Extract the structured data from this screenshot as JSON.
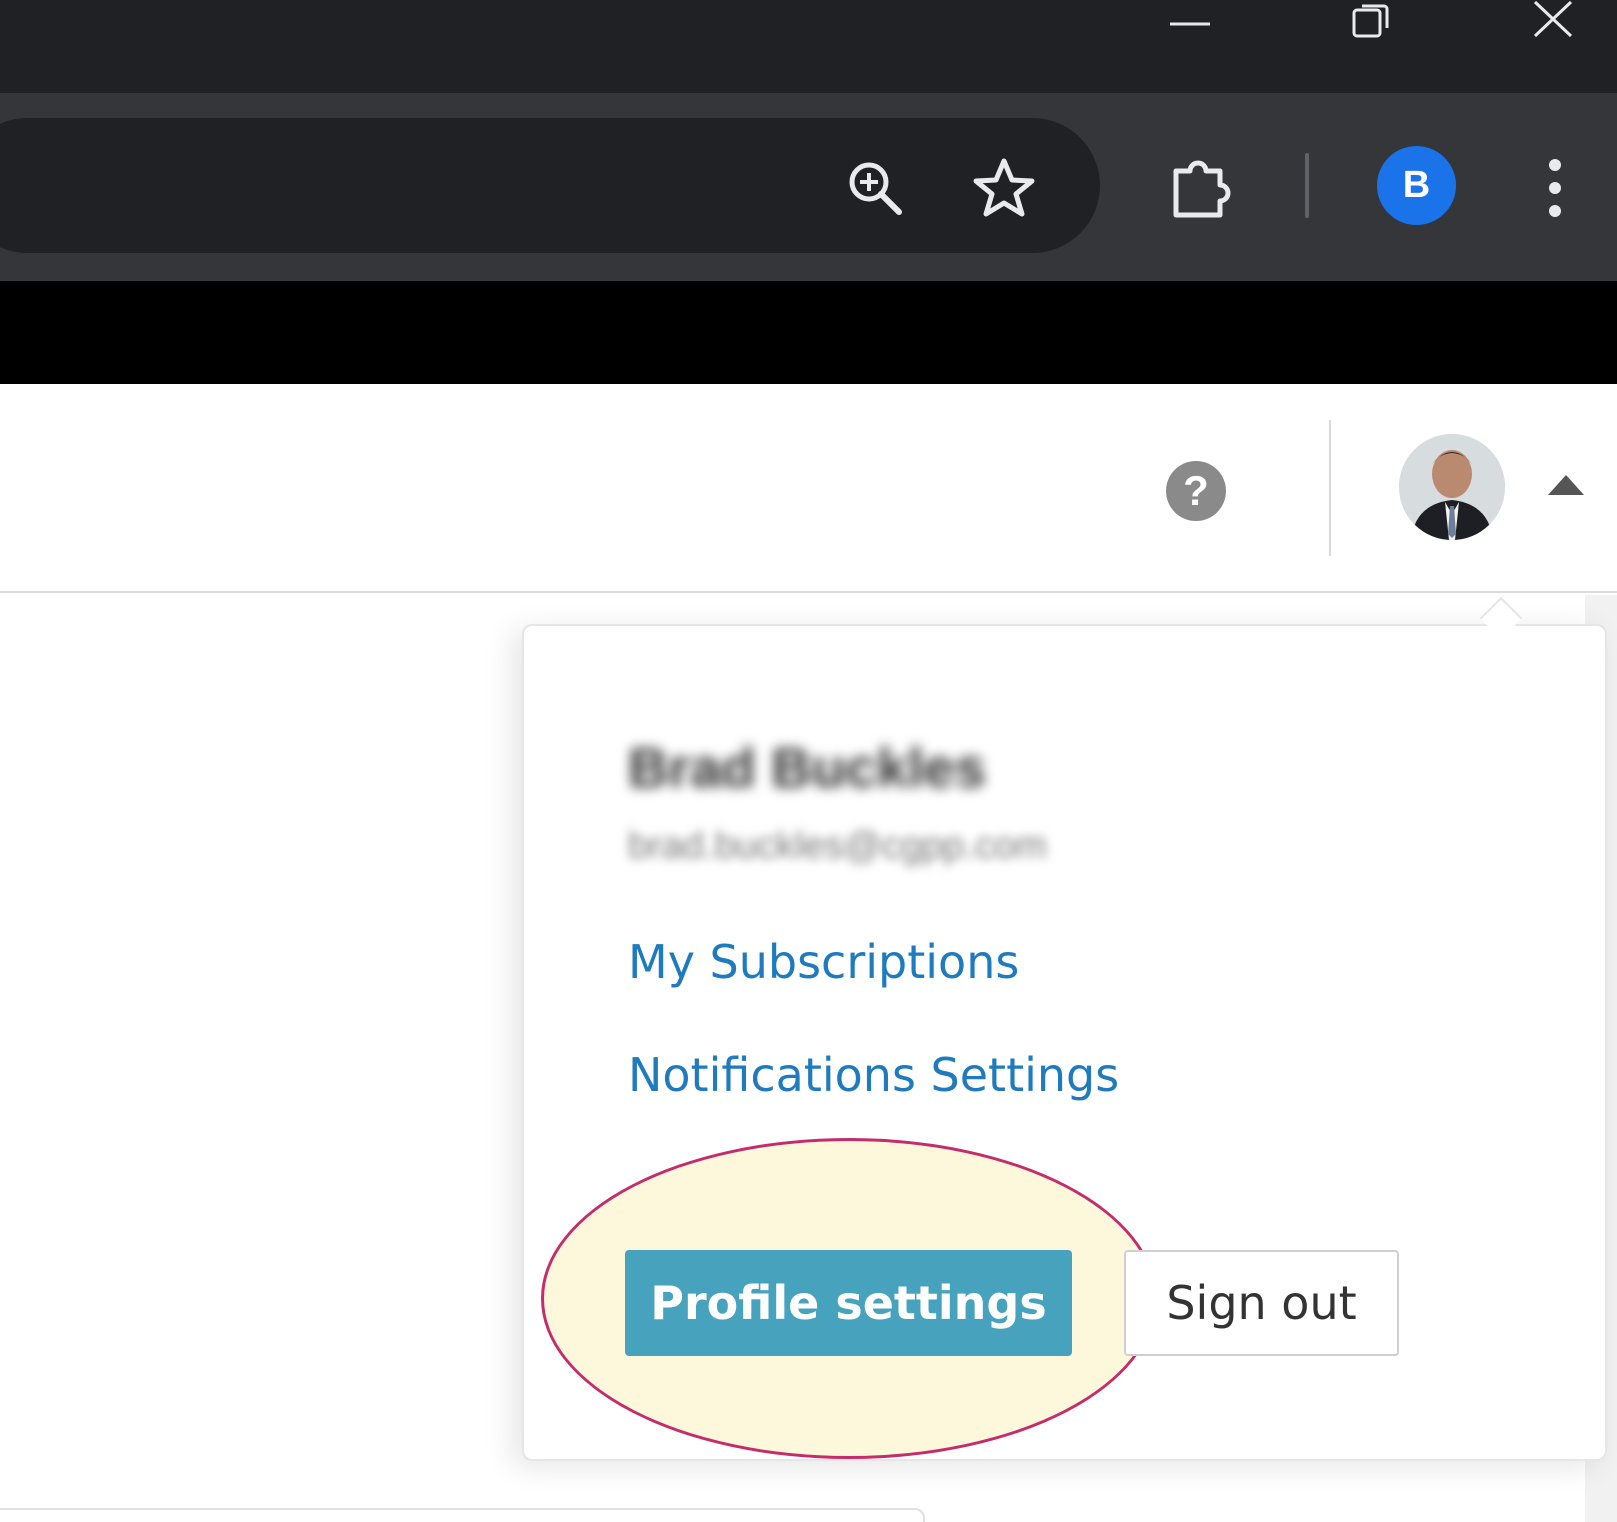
{
  "browser": {
    "profile_initial": "B",
    "profile_color": "#1a73e8",
    "icons": [
      "minimize-icon",
      "maximize-icon",
      "close-icon",
      "zoom-in-icon",
      "star-icon",
      "extensions-icon",
      "kebab-menu-icon"
    ]
  },
  "header": {
    "help_symbol": "?",
    "avatar_icon": "user-avatar"
  },
  "dropdown": {
    "user_name": "Brad Buckles",
    "user_email": "brad.buckles@cgpp.com",
    "links": [
      {
        "label": "My Subscriptions"
      },
      {
        "label": "Notifications Settings"
      }
    ],
    "profile_button": "Profile settings",
    "signout_button": "Sign out",
    "accent_color": "#47a3bd",
    "link_color": "#1f7bbd",
    "highlight_color": "#c42c6b"
  }
}
